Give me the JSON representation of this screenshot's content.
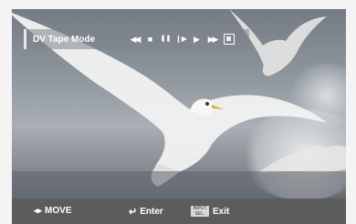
{
  "toolbar": {
    "title": "DV Tape Mode",
    "controls": [
      {
        "name": "rewind-button",
        "glyph": "◀◀"
      },
      {
        "name": "stop-button",
        "glyph": "■"
      },
      {
        "name": "pause-button",
        "glyph": "❚❚"
      },
      {
        "name": "step-button",
        "glyph": "❙▶"
      },
      {
        "name": "play-button",
        "glyph": "▶"
      },
      {
        "name": "fast-forward-button",
        "glyph": "▶▶"
      },
      {
        "name": "record-button",
        "glyph": ""
      }
    ]
  },
  "footer": {
    "move_icon": "◂▸",
    "move_label": "MOVE",
    "enter_icon": "↵",
    "enter_label": "Enter",
    "exit_icon_top": "INPUT",
    "exit_icon_bottom": "SEL.",
    "exit_label": "Exit"
  }
}
